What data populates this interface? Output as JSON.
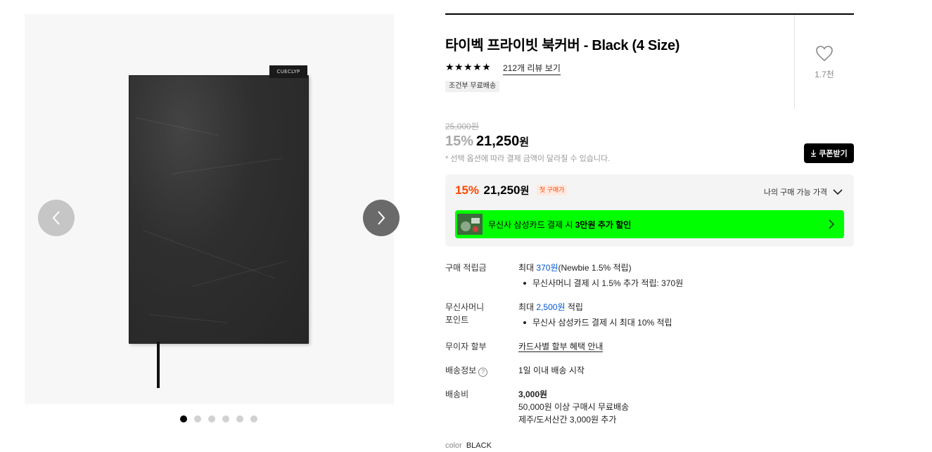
{
  "gallery": {
    "cover_tag": "CUECLYP",
    "dots_count": 6,
    "active_dot": 0,
    "prev_icon": "chevron-left-icon",
    "next_icon": "chevron-right-icon"
  },
  "product": {
    "title": "타이벡 프라이빗 북커버 - Black (4 Size)",
    "stars": "★★★★★",
    "reviews_link": "212개 리뷰 보기",
    "shipping_badge": "조건부 무료배송",
    "like_count": "1.7천",
    "like_icon": "heart-icon"
  },
  "price": {
    "original": "25,000원",
    "discount_pct": "15%",
    "sale_amount": "21,250",
    "won": "원",
    "note": "* 선택 옵션에 따라 결제 금액이 달라질 수 있습니다.",
    "coupon_label": "쿠폰받기",
    "coupon_icon": "download-icon"
  },
  "my_price": {
    "discount_pct": "15%",
    "amount": "21,250",
    "won": "원",
    "first_badge": "첫 구매가",
    "toggle_label": "나의 구매 가능 가격",
    "banner_text_prefix": "무신사 삼성카드 결제 시 ",
    "banner_text_bold": "3만원 추가 할인",
    "banner_color": "#00ff00",
    "accent_color": "#ff4800"
  },
  "info": {
    "points_label": "구매 적립금",
    "points_prefix": "최대 ",
    "points_amount": "370원",
    "points_suffix": "(Newbie 1.5% 적립)",
    "points_bullet": "무신사머니 결제 시 1.5% 추가 적립: 370원",
    "money_label_1": "무신사머니",
    "money_label_2": "포인트",
    "money_prefix": "최대 ",
    "money_amount": "2,500원",
    "money_suffix": " 적립",
    "money_bullet": "무신사 삼성카드 결제 시 최대 10% 적립",
    "installment_label": "무이자 할부",
    "installment_link": "카드사별 할부 혜택 안내",
    "delivery_label": "배송정보",
    "delivery_help": "?",
    "delivery_value": "1일 이내 배송 시작",
    "fee_label": "배송비",
    "fee_amount": "3,000원",
    "fee_free": "50,000원 이상 구매시 무료배송",
    "fee_island": "제주/도서산간 3,000원 추가",
    "link_color": "#0055d1"
  },
  "option": {
    "color_label": "color",
    "color_value": "BLACK"
  }
}
